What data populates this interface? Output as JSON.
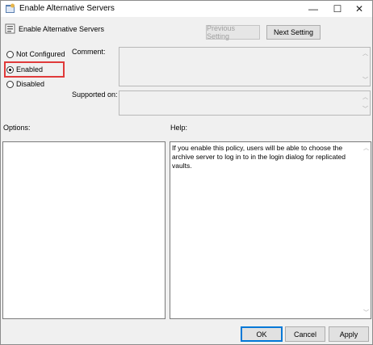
{
  "window": {
    "title": "Enable Alternative Servers",
    "minimize_glyph": "—",
    "maximize_glyph": "☐",
    "close_glyph": "✕"
  },
  "header": {
    "title": "Enable Alternative Servers",
    "prev_label": "Previous Setting",
    "next_label": "Next Setting"
  },
  "state": {
    "options": [
      {
        "label": "Not Configured",
        "selected": false
      },
      {
        "label": "Enabled",
        "selected": true
      },
      {
        "label": "Disabled",
        "selected": false
      }
    ]
  },
  "comment_label": "Comment:",
  "supported_label": "Supported on:",
  "options_label": "Options:",
  "help_label": "Help:",
  "help_text": "If you enable this policy, users will be able to choose the archive server to log in to in the login dialog for replicated vaults.",
  "footer": {
    "ok_label": "OK",
    "cancel_label": "Cancel",
    "apply_label": "Apply"
  },
  "colors": {
    "highlight": "#e03a3a",
    "accent": "#0078d7"
  }
}
